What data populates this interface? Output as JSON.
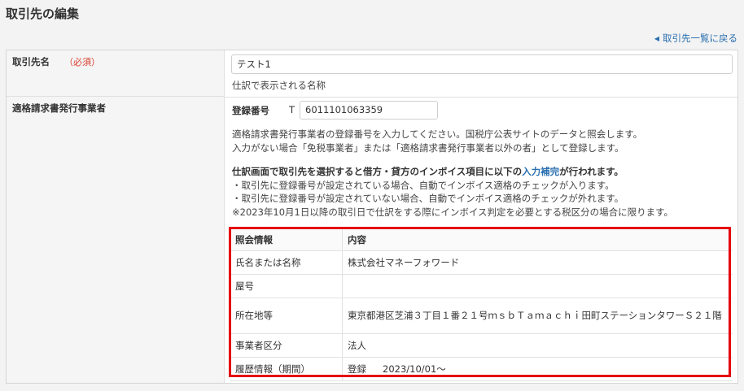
{
  "page_title": "取引先の編集",
  "back_link": "取引先一覧に戻る",
  "fields": {
    "name": {
      "label": "取引先名",
      "required": "（必須）",
      "value": "テスト1",
      "hint": "仕訳で表示される名称"
    },
    "invoice": {
      "label": "適格請求書発行事業者",
      "reg_label": "登録番号",
      "reg_prefix": "T",
      "reg_value": "6011101063359",
      "desc_line1": "適格請求書発行事業者の登録番号を入力してください。国税庁公表サイトのデータと照会します。",
      "desc_line2": "入力がない場合「免税事業者」または「適格請求書発行事業者以外の者」として登録します。",
      "note_bold_before": "仕訳画面で取引先を選択すると借方・貸方のインボイス項目に以下の",
      "note_link": "入力補完",
      "note_bold_after": "が行われます。",
      "note_line1": "・取引先に登録番号が設定されている場合、自動でインボイス適格のチェックが入ります。",
      "note_line2": "・取引先に登録番号が設定されていない場合、自動でインボイス適格のチェックが外れます。",
      "note_line3": "※2023年10月1日以降の取引日で仕訳をする際にインボイス判定を必要とする税区分の場合に限ります。"
    }
  },
  "info_table": {
    "header_key": "照会情報",
    "header_value": "内容",
    "rows": [
      {
        "key": "氏名または名称",
        "value": "株式会社マネーフォワード"
      },
      {
        "key": "屋号",
        "value": ""
      },
      {
        "key": "所在地等",
        "value": "東京都港区芝浦３丁目１番２１号ｍｓｂＴａｍａｃｈｉ田町ステーションタワーＳ２１階"
      },
      {
        "key": "事業者区分",
        "value": "法人"
      },
      {
        "key": "履歴情報（期間）",
        "value": "登録",
        "value_date": "2023/10/01〜"
      }
    ]
  },
  "colors": {
    "link": "#2a6fb0",
    "required": "#d83b2c",
    "highlight_box": "#e5000f"
  }
}
